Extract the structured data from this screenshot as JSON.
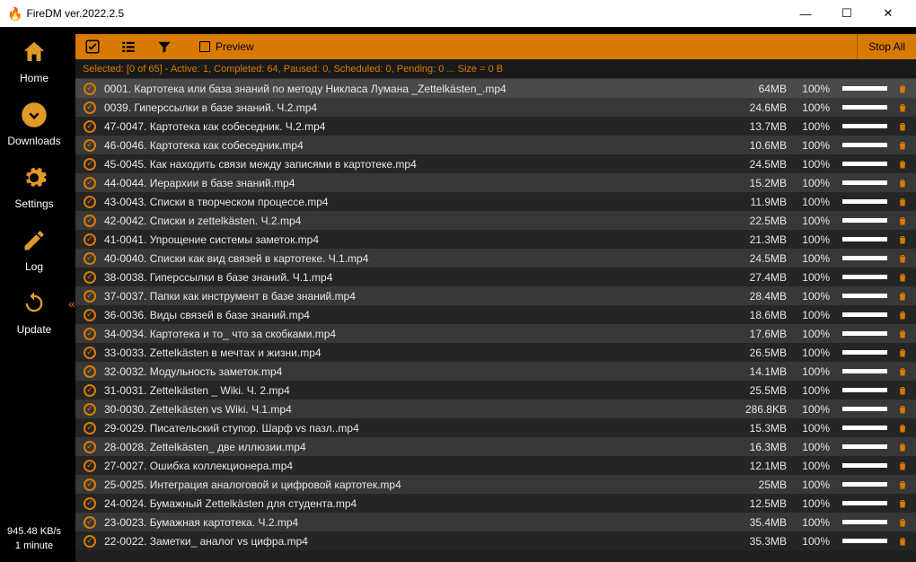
{
  "title": "FireDM ver.2022.2.5",
  "nav": {
    "home": "Home",
    "downloads": "Downloads",
    "settings": "Settings",
    "log": "Log",
    "update": "Update"
  },
  "stats": {
    "speed": "945.48 KB/s",
    "time": "1 minute"
  },
  "toolbar": {
    "preview": "Preview",
    "stopall": "Stop All"
  },
  "status": "Selected: [0 of 65] - Active: 1, Completed: 64,  Paused: 0,  Scheduled: 0, Pending: 0   ... Size = 0 B",
  "items": [
    {
      "name": "0001. Картотека или база знаний по методу Никласа Лумана _Zettelkästen_.mp4",
      "size": "64MB",
      "pct": "100%"
    },
    {
      "name": "0039. Гиперссылки в базе знаний. Ч.2.mp4",
      "size": "24.6MB",
      "pct": "100%"
    },
    {
      "name": "47-0047. Картотека как собеседник. Ч.2.mp4",
      "size": "13.7MB",
      "pct": "100%"
    },
    {
      "name": "46-0046. Картотека как собеседник.mp4",
      "size": "10.6MB",
      "pct": "100%"
    },
    {
      "name": "45-0045. Как находить связи между записями в картотеке.mp4",
      "size": "24.5MB",
      "pct": "100%"
    },
    {
      "name": "44-0044. Иерархии в базе знаний.mp4",
      "size": "15.2MB",
      "pct": "100%"
    },
    {
      "name": "43-0043. Списки в творческом процессе.mp4",
      "size": "11.9MB",
      "pct": "100%"
    },
    {
      "name": "42-0042. Списки и zettelkästen. Ч.2.mp4",
      "size": "22.5MB",
      "pct": "100%"
    },
    {
      "name": "41-0041. Упрощение системы заметок.mp4",
      "size": "21.3MB",
      "pct": "100%"
    },
    {
      "name": "40-0040. Списки как вид связей в картотеке. Ч.1.mp4",
      "size": "24.5MB",
      "pct": "100%"
    },
    {
      "name": "38-0038. Гиперссылки в базе знаний. Ч.1.mp4",
      "size": "27.4MB",
      "pct": "100%"
    },
    {
      "name": "37-0037. Папки как инструмент в базе знаний.mp4",
      "size": "28.4MB",
      "pct": "100%"
    },
    {
      "name": "36-0036. Виды связей в базе знаний.mp4",
      "size": "18.6MB",
      "pct": "100%"
    },
    {
      "name": "34-0034. Картотека и то_ что за скобками.mp4",
      "size": "17.6MB",
      "pct": "100%"
    },
    {
      "name": "33-0033. Zettelkästen в мечтах и жизни.mp4",
      "size": "26.5MB",
      "pct": "100%"
    },
    {
      "name": "32-0032. Модульность заметок.mp4",
      "size": "14.1MB",
      "pct": "100%"
    },
    {
      "name": "31-0031. Zettelkästen _ Wiki. Ч. 2.mp4",
      "size": "25.5MB",
      "pct": "100%"
    },
    {
      "name": "30-0030. Zettelkästen vs Wiki. Ч.1.mp4",
      "size": "286.8KB",
      "pct": "100%"
    },
    {
      "name": "29-0029. Писательский ступор. Шарф vs пазл..mp4",
      "size": "15.3MB",
      "pct": "100%"
    },
    {
      "name": "28-0028. Zettelkästen_ две иллюзии.mp4",
      "size": "16.3MB",
      "pct": "100%"
    },
    {
      "name": "27-0027. Ошибка коллекционера.mp4",
      "size": "12.1MB",
      "pct": "100%"
    },
    {
      "name": "25-0025. Интеграция аналоговой и цифровой картотек.mp4",
      "size": "25MB",
      "pct": "100%"
    },
    {
      "name": "24-0024. Бумажный Zettelkästen для студента.mp4",
      "size": "12.5MB",
      "pct": "100%"
    },
    {
      "name": "23-0023. Бумажная картотека. Ч.2.mp4",
      "size": "35.4MB",
      "pct": "100%"
    },
    {
      "name": "22-0022. Заметки_ аналог vs цифра.mp4",
      "size": "35.3MB",
      "pct": "100%"
    }
  ]
}
